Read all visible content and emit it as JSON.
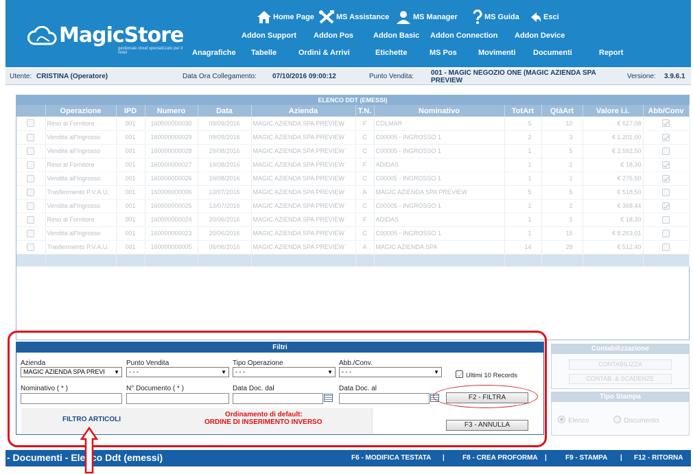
{
  "header": {
    "logo_text": "MagicStore",
    "logo_subtitle": "gestionale cloud specializzato per il retail",
    "top_nav": [
      {
        "label": "Home Page",
        "icon": "home-icon"
      },
      {
        "label": "MS Assistance",
        "icon": "tools-icon"
      },
      {
        "label": "MS Manager",
        "icon": "user-icon"
      },
      {
        "label": "MS Guida",
        "icon": "question-icon"
      },
      {
        "label": "Esci",
        "icon": "exit-icon"
      }
    ],
    "addon_nav": [
      "Addon Support",
      "Addon Pos",
      "Addon Basic",
      "Addon Connection",
      "Addon Device"
    ],
    "main_nav": [
      "Anagrafiche",
      "Tabelle",
      "Ordini & Arrivi",
      "Etichette",
      "MS Pos",
      "Movimenti",
      "Documenti",
      "Report"
    ]
  },
  "info": {
    "user_label": "Utente:",
    "user_value": "CRISTINA (Operatore)",
    "date_label": "Data Ora Collegamento:",
    "date_value": "07/10/2016 09:00:12",
    "pv_label": "Punto Vendita:",
    "pv_value": "001 - MAGIC NEGOZIO ONE (MAGIC AZIENDA SPA PREVIEW",
    "version_label": "Versione:",
    "version_value": "3.9.6.1"
  },
  "table": {
    "caption": "ELENCO DDT (EMESSI)",
    "columns": [
      "",
      "Operazione",
      "IPD",
      "Numero",
      "Data",
      "Azienda",
      "T.N.",
      "Nominativo",
      "TotArt",
      "QtàArt",
      "Valore i.i.",
      "Abb/Conv"
    ],
    "rows": [
      {
        "op": "Reso al Fornitore",
        "ipd": "001",
        "num": "160000000030",
        "data": "09/09/2016",
        "az": "MAGIC AZIENDA SPA PREVIEW",
        "tn": "F",
        "nom": "COLMAR",
        "tot": "5",
        "qta": "10",
        "val": "€ 627,08",
        "abb": true
      },
      {
        "op": "Vendita all'Ingrosso",
        "ipd": "001",
        "num": "160000000029",
        "data": "09/09/2016",
        "az": "MAGIC AZIENDA SPA PREVIEW",
        "tn": "C",
        "nom": "C00005 - INGROSSO 1",
        "tot": "2",
        "qta": "3",
        "val": "€ 1.201,00",
        "abb": true
      },
      {
        "op": "Vendita all'Ingrosso",
        "ipd": "001",
        "num": "160000000028",
        "data": "29/08/2016",
        "az": "MAGIC AZIENDA SPA PREVIEW",
        "tn": "C",
        "nom": "C00005 - INGROSSO 1",
        "tot": "1",
        "qta": "5",
        "val": "€ 2.592,50",
        "abb": false
      },
      {
        "op": "Reso al Fornitore",
        "ipd": "001",
        "num": "160000000027",
        "data": "19/08/2016",
        "az": "MAGIC AZIENDA SPA PREVIEW",
        "tn": "F",
        "nom": "ADIDAS",
        "tot": "1",
        "qta": "1",
        "val": "€ 18,30",
        "abb": true
      },
      {
        "op": "Vendita all'Ingrosso",
        "ipd": "001",
        "num": "160000000026",
        "data": "19/08/2016",
        "az": "MAGIC AZIENDA SPA PREVIEW",
        "tn": "C",
        "nom": "C00005 - INGROSSO 1",
        "tot": "1",
        "qta": "1",
        "val": "€ 275,50",
        "abb": true
      },
      {
        "op": "Trasferimento P.V.A.U.",
        "ipd": "001",
        "num": "160000000006",
        "data": "13/07/2016",
        "az": "MAGIC AZIENDA SPA PREVIEW",
        "tn": "A",
        "nom": "MAGIC AZIENDA SPA PREVIEW",
        "tot": "5",
        "qta": "5",
        "val": "€ 518,50",
        "abb": false
      },
      {
        "op": "Vendita all'Ingrosso",
        "ipd": "001",
        "num": "160000000025",
        "data": "13/07/2016",
        "az": "MAGIC AZIENDA SPA PREVIEW",
        "tn": "C",
        "nom": "C00005 - INGROSSO 1",
        "tot": "1",
        "qta": "2",
        "val": "€ 368,44",
        "abb": true
      },
      {
        "op": "Reso al Fornitore",
        "ipd": "001",
        "num": "160000000024",
        "data": "20/06/2016",
        "az": "MAGIC AZIENDA SPA PREVIEW",
        "tn": "F",
        "nom": "ADIDAS",
        "tot": "1",
        "qta": "1",
        "val": "€ 18,30",
        "abb": false
      },
      {
        "op": "Vendita all'Ingrosso",
        "ipd": "001",
        "num": "160000000023",
        "data": "20/06/2016",
        "az": "MAGIC AZIENDA SPA PREVIEW",
        "tn": "C",
        "nom": "C00005 - INGROSSO 1",
        "tot": "1",
        "qta": "15",
        "val": "€ 8.263,01",
        "abb": false
      },
      {
        "op": "Trasferimento P.V.A.U.",
        "ipd": "001",
        "num": "160000000005",
        "data": "06/06/2016",
        "az": "MAGIC AZIENDA SPA PREVIEW",
        "tn": "A",
        "nom": "MAGIC AZIENDA SPA",
        "tot": "14",
        "qta": "28",
        "val": "€ 512,40",
        "abb": false
      }
    ]
  },
  "filtri": {
    "caption": "Filtri",
    "azienda_label": "Azienda",
    "azienda_value": "MAGIC AZIENDA SPA PREVI",
    "pv_label": "Punto Vendita",
    "pv_value": "- - -",
    "tipo_label": "Tipo Operazione",
    "tipo_value": "- - -",
    "abb_label": "Abb./Conv.",
    "abb_value": "- - -",
    "ultimi_label": "Ultimi 10 Records",
    "nominativo_label": "Nominativo ( * )",
    "ndoc_label": "N° Documento ( * )",
    "dal_label": "Data Doc. dal",
    "al_label": "Data Doc. al",
    "filtra_btn": "F2 - FILTRA",
    "annulla_btn": "F3 - ANNULLA",
    "articoli_label": "FILTRO ARTICOLI",
    "ordinamento_1": "Ordinamento di default:",
    "ordinamento_2": "ORDINE DI INSERIMENTO INVERSO"
  },
  "contab": {
    "caption": "Contabilizzazione",
    "btn1": "CONTABILIZZA",
    "btn2": "CONTAB. & SCADENZE"
  },
  "stampa": {
    "caption": "Tipo Stampa",
    "opt1": "Elenco",
    "opt2": "Documento"
  },
  "footer": {
    "title": "- Documenti - Elenco Ddt (emessi)",
    "f6": "F6 - MODIFICA TESTATA",
    "f8": "F8 - CREA PROFORMA",
    "f9": "F9 - STAMPA",
    "f12": "F12 - RITORNA",
    "sep": "|"
  },
  "colors": {
    "header_blue": "#1f86c8",
    "footer_blue": "#1760a8",
    "highlight_red": "#e0101a"
  }
}
